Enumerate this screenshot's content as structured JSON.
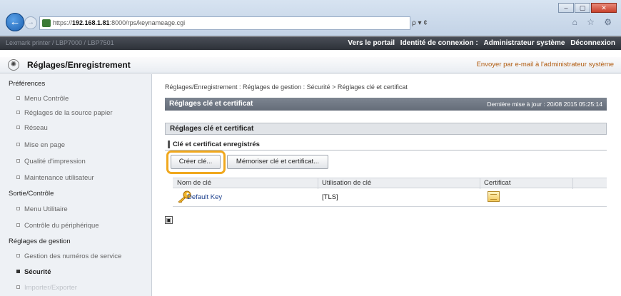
{
  "browser": {
    "url_prefix": "https://",
    "url_host": "192.168.1.81",
    "url_path": ":8000/rps/keynameage.cgi",
    "addr_tools": "ρ ▾ ¢",
    "chrome_icons": "⌂ ☆ ⚙",
    "window_buttons": {
      "minimize": "–",
      "maximize": "▢",
      "close": "✕"
    }
  },
  "topbar": {
    "device_name": "Lexmark printer / LBP7000 / LBP7501",
    "portal": "Vers le portail",
    "login_label": "Identité de connexion :",
    "user": "Administrateur système",
    "logout": "Déconnexion"
  },
  "header": {
    "title": "Réglages/Enregistrement",
    "mail_link": "Envoyer par e-mail à l'administrateur système"
  },
  "sidebar": {
    "groups": [
      {
        "label": "Préférences",
        "items": [
          "Menu Contrôle",
          "Réglages de la source papier",
          "Réseau",
          "Mise en page",
          "Qualité d'impression",
          "Maintenance utilisateur"
        ]
      },
      {
        "label": "Sortie/Contrôle",
        "items": [
          "Menu Utilitaire",
          "Contrôle du périphérique"
        ]
      },
      {
        "label": "Réglages de gestion",
        "items": [
          "Gestion des numéros de service",
          "Sécurité",
          "Importer/Exporter"
        ]
      }
    ]
  },
  "main": {
    "breadcrumb": "Réglages/Enregistrement : Réglages de gestion : Sécurité > Réglages clé et certificat",
    "header_title": "Réglages clé et certificat",
    "last_update": "Dernière mise à jour : 20/08 2015 05:25:14",
    "section_title": "Réglages clé et certificat",
    "subsection_title": "Clé et certificat enregistrés",
    "create_key_button": "Créer clé...",
    "save_key_button": "Mémoriser clé et certificat...",
    "table": {
      "columns": [
        "Nom de clé",
        "Utilisation de clé",
        "Certificat"
      ],
      "rows": [
        {
          "name": "Default Key",
          "usage": "[TLS]"
        }
      ]
    },
    "print_icon": "▣"
  }
}
